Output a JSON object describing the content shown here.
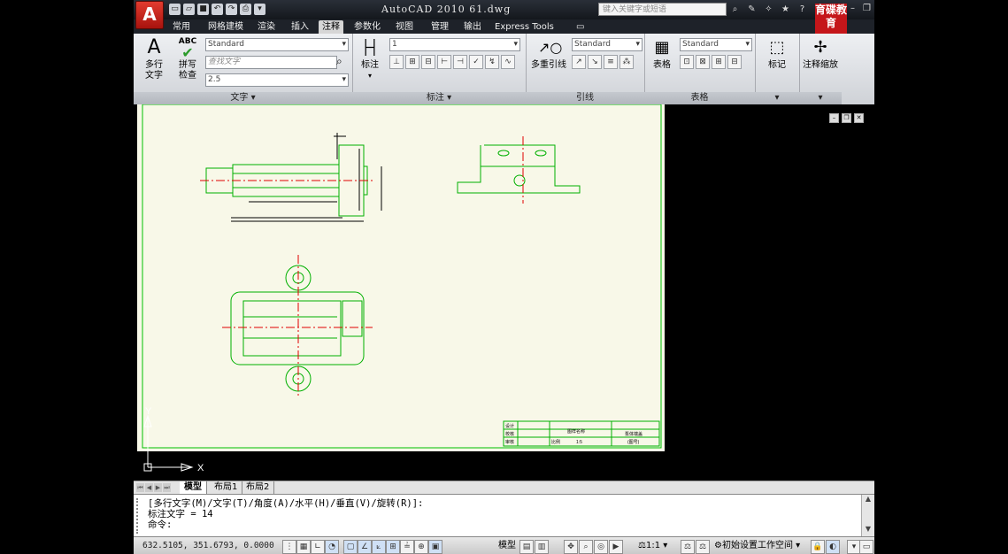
{
  "title": "AutoCAD 2010   61.dwg",
  "search_placeholder": "键入关键字或短语",
  "brand": "育碟教育",
  "menu_tabs": [
    {
      "label": "常用",
      "active": false
    },
    {
      "label": "网格建模",
      "active": false
    },
    {
      "label": "渲染",
      "active": false
    },
    {
      "label": "插入",
      "active": false
    },
    {
      "label": "注释",
      "active": true
    },
    {
      "label": "参数化",
      "active": false
    },
    {
      "label": "视图",
      "active": false
    },
    {
      "label": "管理",
      "active": false
    },
    {
      "label": "输出",
      "active": false
    },
    {
      "label": "Express Tools",
      "active": false
    }
  ],
  "ribbon": {
    "text_panel": {
      "title": "文字",
      "mtext_label": "多行\n文字",
      "spell_label": "拼写\n检查",
      "spell_icon_text": "ABC",
      "style_value": "Standard",
      "find_placeholder": "查找文字",
      "height_value": "2.5"
    },
    "dim_panel": {
      "title": "标注",
      "dim_label": "标注",
      "scale_value": "1"
    },
    "leader_panel": {
      "title": "引线",
      "mleader_label": "多重引线",
      "style_value": "Standard"
    },
    "table_panel": {
      "title": "表格",
      "table_label": "表格",
      "style_value": "Standard"
    },
    "markup_panel": {
      "label": "标记"
    },
    "scale_panel": {
      "label": "注释缩放"
    }
  },
  "drawing": {
    "ucs_y": "Y",
    "ucs_x": "X",
    "title_block": {
      "c1": "设计",
      "c2": "校核",
      "c3": "审核",
      "name": "图样名称",
      "scale_label": "比例",
      "scale": "1:5",
      "part": "泵体端盖",
      "drawing_no": "(图号)"
    }
  },
  "layout_tabs": [
    {
      "label": "模型",
      "active": true
    },
    {
      "label": "布局1",
      "active": false
    },
    {
      "label": "布局2",
      "active": false
    }
  ],
  "command": {
    "line1": "[多行文字(M)/文字(T)/角度(A)/水平(H)/垂直(V)/旋转(R)]:",
    "line2": "标注文字 = 14",
    "line3": "命令:"
  },
  "status": {
    "coords": "632.5105, 351.6793, 0.0000",
    "model_label": "模型",
    "anno_scale": "1:1",
    "workspace": "初始设置工作空间"
  }
}
